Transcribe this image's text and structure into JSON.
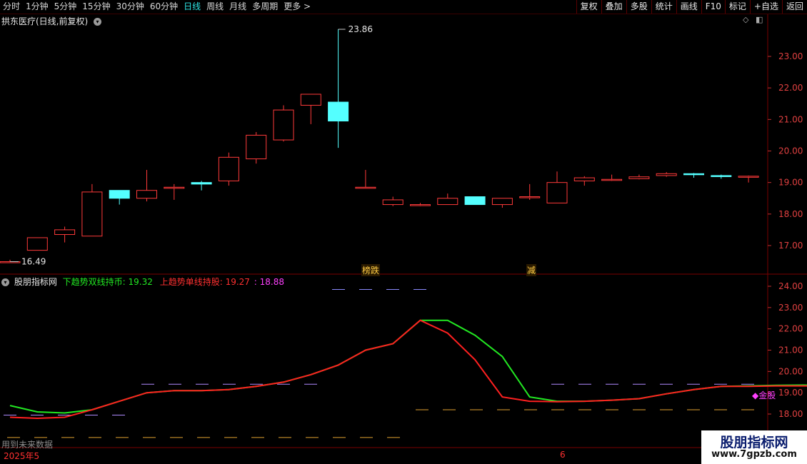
{
  "toolbar": {
    "periods": [
      "分时",
      "1分钟",
      "5分钟",
      "15分钟",
      "30分钟",
      "60分钟",
      "日线",
      "周线",
      "月线",
      "多周期",
      "更多 >"
    ],
    "active_period": "日线",
    "buttons": [
      "复权",
      "叠加",
      "多股",
      "统计",
      "画线",
      "F10",
      "标记",
      "+自选",
      "返回"
    ]
  },
  "main_chart": {
    "stock_title": "拱东医疗(日线,前复权)",
    "high_label": "23.86",
    "low_label": "16.49",
    "marker_1": "榜跌",
    "marker_2": "减",
    "y_ticks": [
      "23.00",
      "22.00",
      "21.00",
      "20.00",
      "19.00",
      "18.00",
      "17.00"
    ]
  },
  "indicator": {
    "name": "股朋指标网",
    "line1_label": "下趋势双线持币: 19.32",
    "line2_label": "上趋势单线持股: 19.27",
    "value3": ": 18.88",
    "gold_tag": "金股",
    "y_ticks": [
      "24.00",
      "23.00",
      "22.00",
      "21.00",
      "20.00",
      "19.00",
      "18.00"
    ]
  },
  "footer": {
    "future_note": "用到未来数据",
    "date_left": "2025年5",
    "date_mid": "6"
  },
  "watermark": {
    "title": "股朋指标网",
    "url": "www.7gpzb.com"
  },
  "colors": {
    "up": "#ff3a3a",
    "down": "#54ffff",
    "green_line": "#22e822",
    "red_line": "#ff2020",
    "purple": "#ff40ff"
  },
  "chart_data": {
    "type": "candlestick",
    "candles": [
      {
        "o": 16.49,
        "c": 16.49,
        "h": 16.55,
        "l": 16.45
      },
      {
        "o": 16.85,
        "c": 17.25,
        "h": 17.25,
        "l": 16.85
      },
      {
        "o": 17.35,
        "c": 17.5,
        "h": 17.6,
        "l": 17.1
      },
      {
        "o": 17.3,
        "c": 18.7,
        "h": 18.95,
        "l": 17.3
      },
      {
        "o": 18.75,
        "c": 18.5,
        "h": 18.75,
        "l": 18.3
      },
      {
        "o": 18.5,
        "c": 18.75,
        "h": 19.4,
        "l": 18.4
      },
      {
        "o": 18.85,
        "c": 18.85,
        "h": 18.95,
        "l": 18.45
      },
      {
        "o": 19.0,
        "c": 18.95,
        "h": 19.05,
        "l": 18.75
      },
      {
        "o": 19.05,
        "c": 19.8,
        "h": 19.95,
        "l": 18.9
      },
      {
        "o": 19.75,
        "c": 20.5,
        "h": 20.6,
        "l": 19.6
      },
      {
        "o": 20.35,
        "c": 21.3,
        "h": 21.45,
        "l": 20.3
      },
      {
        "o": 21.45,
        "c": 21.8,
        "h": 21.8,
        "l": 20.85
      },
      {
        "o": 21.55,
        "c": 20.95,
        "h": 23.86,
        "l": 20.1
      },
      {
        "o": 18.85,
        "c": 18.85,
        "h": 19.4,
        "l": 18.85
      },
      {
        "o": 18.3,
        "c": 18.45,
        "h": 18.55,
        "l": 18.25
      },
      {
        "o": 18.3,
        "c": 18.3,
        "h": 18.35,
        "l": 18.25
      },
      {
        "o": 18.3,
        "c": 18.5,
        "h": 18.65,
        "l": 18.3
      },
      {
        "o": 18.55,
        "c": 18.3,
        "h": 18.55,
        "l": 18.3
      },
      {
        "o": 18.3,
        "c": 18.5,
        "h": 18.5,
        "l": 18.2
      },
      {
        "o": 18.55,
        "c": 18.55,
        "h": 18.95,
        "l": 18.45
      },
      {
        "o": 18.35,
        "c": 19.0,
        "h": 19.35,
        "l": 18.35
      },
      {
        "o": 19.05,
        "c": 19.15,
        "h": 19.2,
        "l": 18.9
      },
      {
        "o": 19.08,
        "c": 19.1,
        "h": 19.25,
        "l": 19.05
      },
      {
        "o": 19.12,
        "c": 19.18,
        "h": 19.25,
        "l": 19.1
      },
      {
        "o": 19.22,
        "c": 19.28,
        "h": 19.33,
        "l": 19.18
      },
      {
        "o": 19.28,
        "c": 19.25,
        "h": 19.3,
        "l": 19.15
      },
      {
        "o": 19.22,
        "c": 19.2,
        "h": 19.25,
        "l": 19.12
      },
      {
        "o": 19.18,
        "c": 19.2,
        "h": 19.22,
        "l": 19.0
      }
    ],
    "up_trend_red": [
      17.85,
      17.8,
      17.85,
      18.2,
      18.6,
      19.0,
      19.1,
      19.1,
      19.15,
      19.3,
      19.5,
      19.85,
      20.3,
      21.0,
      21.3,
      22.4,
      21.8,
      20.55,
      18.8,
      18.6,
      18.58,
      18.6,
      18.65,
      18.72,
      18.95,
      19.15,
      19.3,
      19.3,
      19.32,
      19.32,
      19.3,
      19.28,
      19.27
    ],
    "down_trend_green": [
      18.4,
      18.1,
      18.05,
      18.2,
      18.6,
      19.0,
      19.1,
      19.1,
      19.15,
      19.3,
      19.5,
      19.85,
      20.3,
      21.0,
      21.3,
      22.4,
      22.4,
      21.7,
      20.7,
      18.8,
      18.6,
      18.6,
      18.65,
      18.72,
      18.95,
      19.15,
      19.3,
      19.32,
      19.35,
      19.36,
      19.35,
      19.33,
      19.32
    ],
    "ylim_main": [
      16.3,
      24.2
    ],
    "ylim_indicator": [
      17.6,
      24.3
    ]
  }
}
